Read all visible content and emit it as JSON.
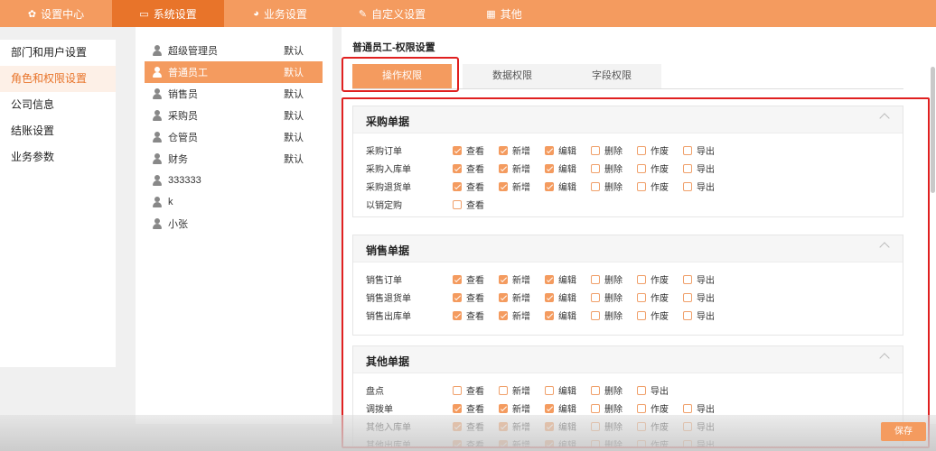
{
  "topnav": [
    {
      "label": "设置中心",
      "icon": "gear-icon",
      "glyph": "✿"
    },
    {
      "label": "系统设置",
      "icon": "monitor-icon",
      "glyph": "▭"
    },
    {
      "label": "业务设置",
      "icon": "pie-chart-icon",
      "glyph": "◕"
    },
    {
      "label": "自定义设置",
      "icon": "edit-icon",
      "glyph": "✎"
    },
    {
      "label": "其他",
      "icon": "grid-icon",
      "glyph": "▦"
    }
  ],
  "leftmenu": [
    {
      "label": "部门和用户设置"
    },
    {
      "label": "角色和权限设置"
    },
    {
      "label": "公司信息"
    },
    {
      "label": "结账设置"
    },
    {
      "label": "业务参数"
    }
  ],
  "roles": [
    {
      "name": "超级管理员",
      "tag": "默认"
    },
    {
      "name": "普通员工",
      "tag": "默认"
    },
    {
      "name": "销售员",
      "tag": "默认"
    },
    {
      "name": "采购员",
      "tag": "默认"
    },
    {
      "name": "仓管员",
      "tag": "默认"
    },
    {
      "name": "财务",
      "tag": "默认"
    },
    {
      "name": "333333",
      "tag": ""
    },
    {
      "name": "k",
      "tag": ""
    },
    {
      "name": "小张",
      "tag": ""
    }
  ],
  "page_title": "普通员工-权限设置",
  "perm_tabs": [
    {
      "label": "操作权限"
    },
    {
      "label": "数据权限"
    },
    {
      "label": "字段权限"
    }
  ],
  "sections": [
    {
      "title": "采购单据",
      "rows": [
        {
          "label": "采购订单",
          "perms": [
            {
              "name": "查看",
              "on": true
            },
            {
              "name": "新增",
              "on": true
            },
            {
              "name": "编辑",
              "on": true
            },
            {
              "name": "删除",
              "on": false
            },
            {
              "name": "作废",
              "on": false
            },
            {
              "name": "导出",
              "on": false
            }
          ]
        },
        {
          "label": "采购入库单",
          "perms": [
            {
              "name": "查看",
              "on": true
            },
            {
              "name": "新增",
              "on": true
            },
            {
              "name": "编辑",
              "on": true
            },
            {
              "name": "删除",
              "on": false
            },
            {
              "name": "作废",
              "on": false
            },
            {
              "name": "导出",
              "on": false
            }
          ]
        },
        {
          "label": "采购退货单",
          "perms": [
            {
              "name": "查看",
              "on": true
            },
            {
              "name": "新增",
              "on": true
            },
            {
              "name": "编辑",
              "on": true
            },
            {
              "name": "删除",
              "on": false
            },
            {
              "name": "作废",
              "on": false
            },
            {
              "name": "导出",
              "on": false
            }
          ]
        },
        {
          "label": "以销定购",
          "perms": [
            {
              "name": "查看",
              "on": false
            }
          ]
        }
      ]
    },
    {
      "title": "销售单据",
      "rows": [
        {
          "label": "销售订单",
          "perms": [
            {
              "name": "查看",
              "on": true
            },
            {
              "name": "新增",
              "on": true
            },
            {
              "name": "编辑",
              "on": true
            },
            {
              "name": "删除",
              "on": false
            },
            {
              "name": "作废",
              "on": false
            },
            {
              "name": "导出",
              "on": false
            }
          ]
        },
        {
          "label": "销售退货单",
          "perms": [
            {
              "name": "查看",
              "on": true
            },
            {
              "name": "新增",
              "on": true
            },
            {
              "name": "编辑",
              "on": true
            },
            {
              "name": "删除",
              "on": false
            },
            {
              "name": "作废",
              "on": false
            },
            {
              "name": "导出",
              "on": false
            }
          ]
        },
        {
          "label": "销售出库单",
          "perms": [
            {
              "name": "查看",
              "on": true
            },
            {
              "name": "新增",
              "on": true
            },
            {
              "name": "编辑",
              "on": true
            },
            {
              "name": "删除",
              "on": false
            },
            {
              "name": "作废",
              "on": false
            },
            {
              "name": "导出",
              "on": false
            }
          ]
        }
      ]
    },
    {
      "title": "其他单据",
      "rows": [
        {
          "label": "盘点",
          "perms": [
            {
              "name": "查看",
              "on": false
            },
            {
              "name": "新增",
              "on": false
            },
            {
              "name": "编辑",
              "on": false
            },
            {
              "name": "删除",
              "on": false
            },
            {
              "name": "导出",
              "on": false
            }
          ]
        },
        {
          "label": "调拨单",
          "perms": [
            {
              "name": "查看",
              "on": true
            },
            {
              "name": "新增",
              "on": true
            },
            {
              "name": "编辑",
              "on": true
            },
            {
              "name": "删除",
              "on": false
            },
            {
              "name": "作废",
              "on": false
            },
            {
              "name": "导出",
              "on": false
            }
          ]
        },
        {
          "label": "其他入库单",
          "perms": [
            {
              "name": "查看",
              "on": true
            },
            {
              "name": "新增",
              "on": true
            },
            {
              "name": "编辑",
              "on": true
            },
            {
              "name": "删除",
              "on": false
            },
            {
              "name": "作废",
              "on": false
            },
            {
              "name": "导出",
              "on": false
            }
          ]
        },
        {
          "label": "其他出库单",
          "perms": [
            {
              "name": "查看",
              "on": true
            },
            {
              "name": "新增",
              "on": true
            },
            {
              "name": "编辑",
              "on": true
            },
            {
              "name": "删除",
              "on": false
            },
            {
              "name": "作废",
              "on": false
            },
            {
              "name": "导出",
              "on": false
            }
          ]
        }
      ]
    }
  ],
  "save_label": "保存",
  "colors": {
    "accent": "#f49b5f",
    "accent_dark": "#e8742a",
    "highlight_box": "#e02020"
  }
}
